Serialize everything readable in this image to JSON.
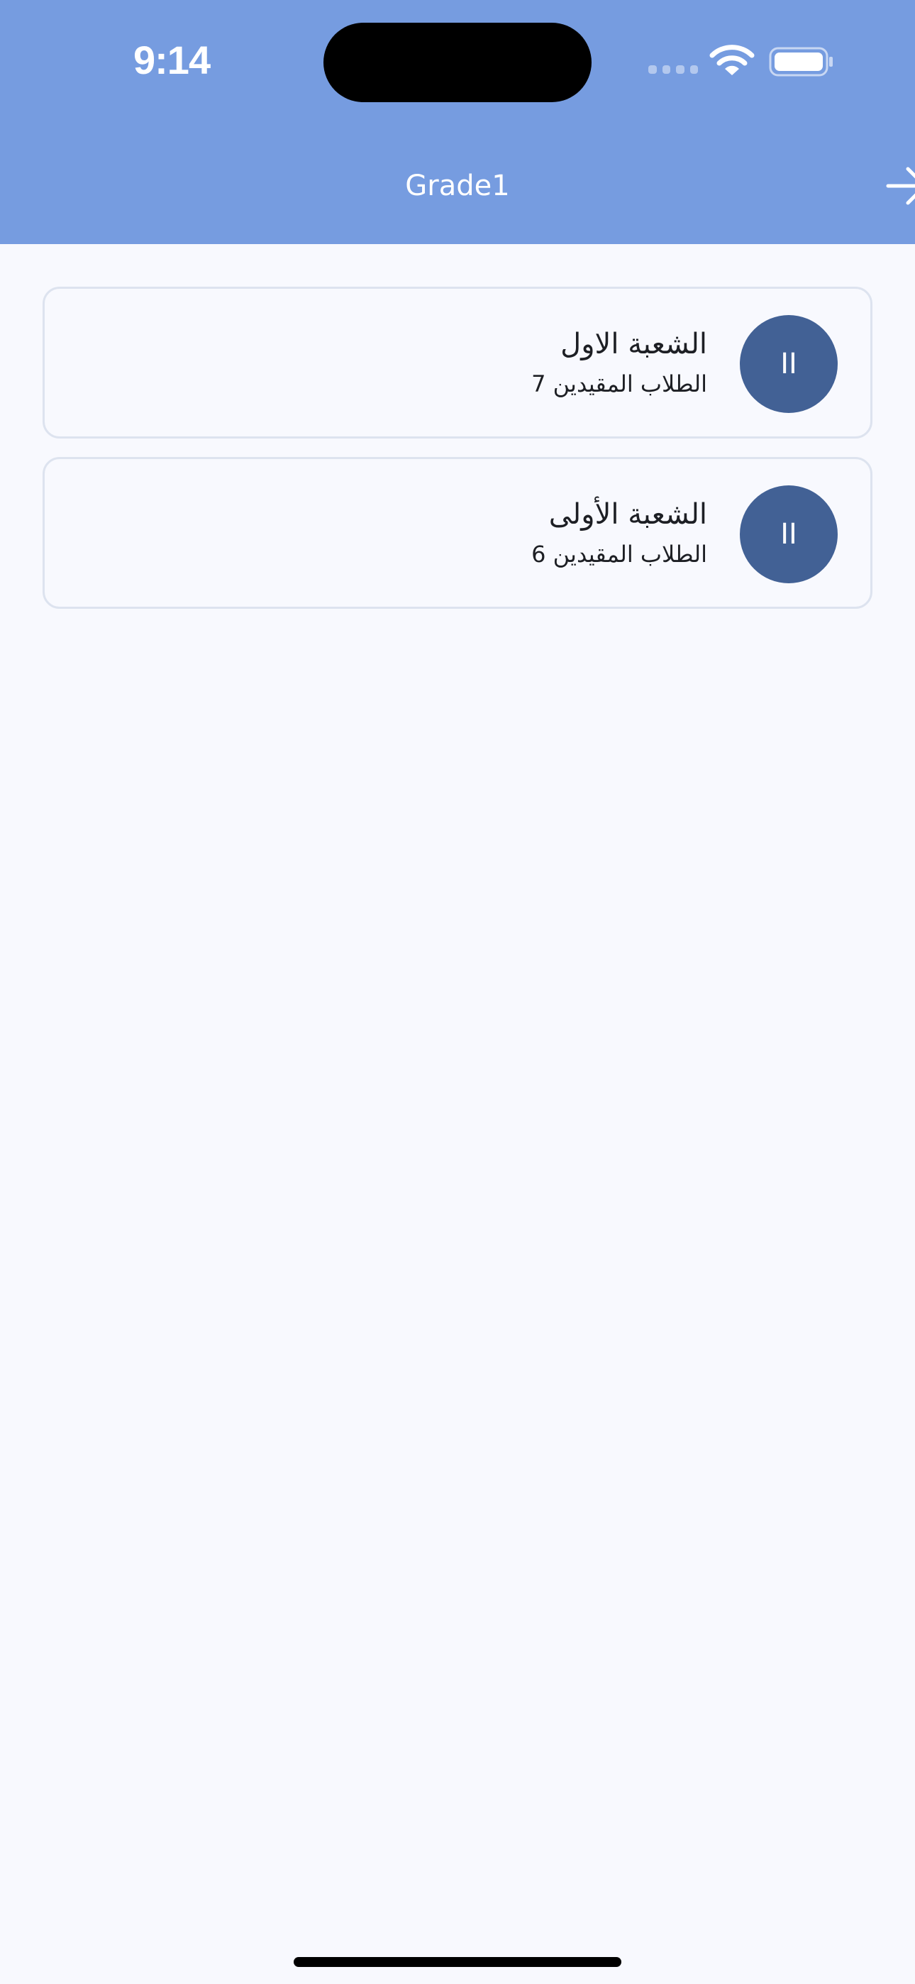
{
  "status_bar": {
    "time": "9:14"
  },
  "header": {
    "title": "Grade1",
    "background_color": "#769ce0",
    "back_icon": "arrow-right-icon"
  },
  "sections": [
    {
      "name": "الشعبة الاول",
      "subtitle": "الطلاب المقيدين 7",
      "avatar_text": "II"
    },
    {
      "name": "الشعبة الأولى",
      "subtitle": "الطلاب المقيدين 6",
      "avatar_text": "II"
    }
  ],
  "colors": {
    "avatar": "#426195",
    "page_background": "#f8f9fe",
    "card_border": "#dde3ef"
  }
}
